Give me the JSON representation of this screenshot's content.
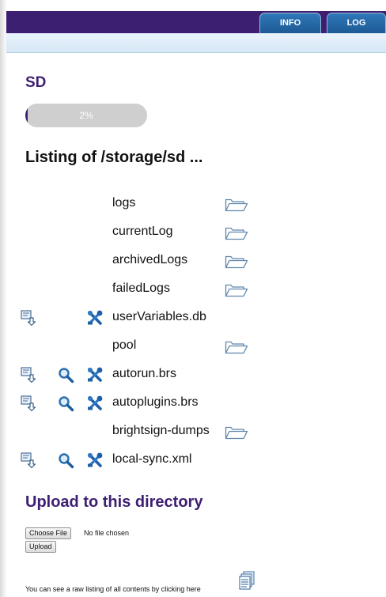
{
  "nav": {
    "tabs": [
      {
        "label": "INFO"
      },
      {
        "label": "LOG"
      }
    ]
  },
  "storage": {
    "heading": "SD",
    "usage_percent": 2,
    "usage_label": "2%"
  },
  "listing": {
    "heading": "Listing of /storage/sd ...",
    "entries": [
      {
        "name": "logs",
        "type": "folder",
        "actions": []
      },
      {
        "name": "currentLog",
        "type": "folder",
        "actions": []
      },
      {
        "name": "archivedLogs",
        "type": "folder",
        "actions": []
      },
      {
        "name": "failedLogs",
        "type": "folder",
        "actions": []
      },
      {
        "name": "userVariables.db",
        "type": "file",
        "actions": [
          "download",
          "edit"
        ]
      },
      {
        "name": "pool",
        "type": "folder",
        "actions": []
      },
      {
        "name": "autorun.brs",
        "type": "file",
        "actions": [
          "download",
          "view",
          "edit"
        ]
      },
      {
        "name": "autoplugins.brs",
        "type": "file",
        "actions": [
          "download",
          "view",
          "edit"
        ]
      },
      {
        "name": "brightsign-dumps",
        "type": "folder",
        "actions": []
      },
      {
        "name": "local-sync.xml",
        "type": "file",
        "actions": [
          "download",
          "view",
          "edit"
        ]
      }
    ]
  },
  "upload": {
    "heading": "Upload to this directory",
    "choose_button": "Choose File",
    "file_status": "No file chosen",
    "upload_button": "Upload"
  },
  "raw_listing": {
    "text": "You can see a raw listing of all contents by clicking here"
  },
  "colors": {
    "brand_purple": "#3d1f72",
    "tab_blue": "#2a6fae",
    "folder_outline": "#6a8fb3",
    "tool_blue": "#1f5fa6"
  },
  "icons": {
    "download": "download-icon",
    "view": "magnifier-icon",
    "edit": "tools-icon",
    "folder": "folder-icon",
    "raw_listing": "document-list-icon"
  }
}
